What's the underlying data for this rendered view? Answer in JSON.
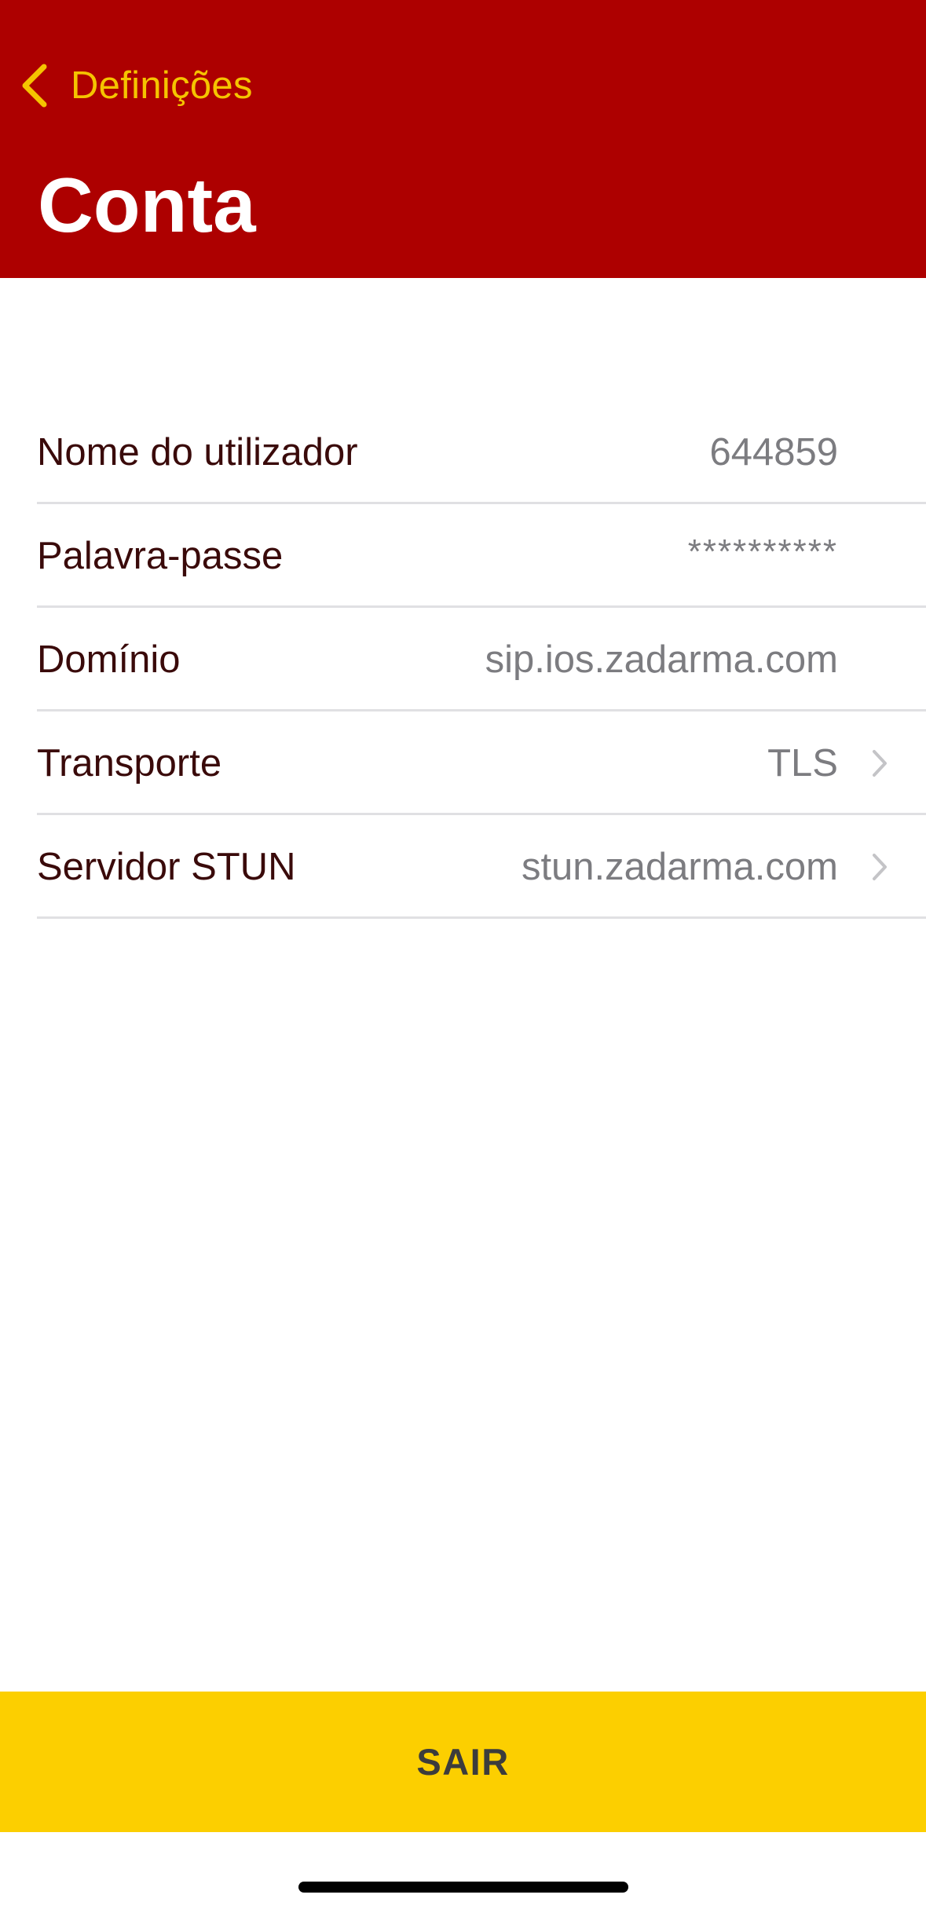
{
  "colors": {
    "header_background": "#ad0000",
    "accent": "#f5c400",
    "logout_background": "#fccf00",
    "label_text": "#3a0a0a",
    "value_text": "#7c7c80"
  },
  "nav": {
    "back_label": "Definições",
    "back_icon": "chevron-left-icon"
  },
  "header": {
    "title": "Conta"
  },
  "settings": {
    "items": [
      {
        "label": "Nome do utilizador",
        "value": "644859"
      },
      {
        "label": "Palavra-passe",
        "value": "**********"
      },
      {
        "label": "Domínio",
        "value": "sip.ios.zadarma.com"
      },
      {
        "label": "Transporte",
        "value": "TLS",
        "icon": "chevron-right-icon"
      },
      {
        "label": "Servidor STUN",
        "value": "stun.zadarma.com",
        "icon": "chevron-right-icon"
      }
    ]
  },
  "footer": {
    "logout_label": "SAIR"
  }
}
